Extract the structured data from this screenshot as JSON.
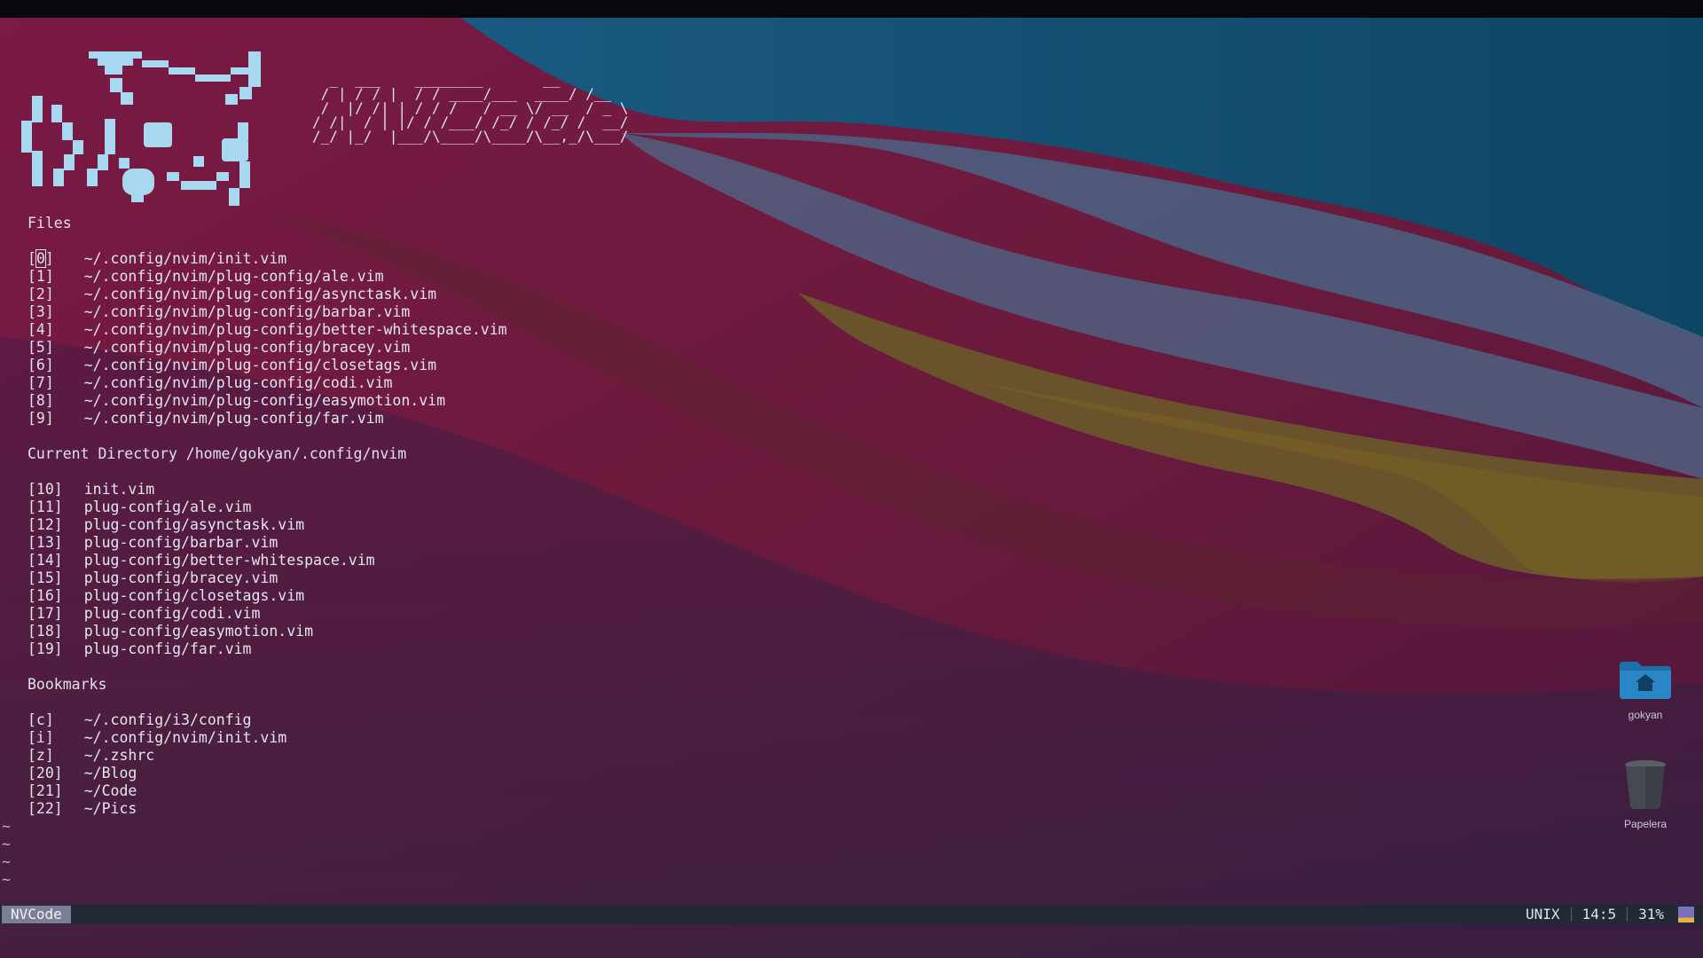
{
  "ascii_logo": "  _  ___    ________       __\n / | / / |  / / ____/___  ____/ /__\n /  |/ /| | / / /   / __ \\/ __  / _ \\\n/ /|  / | |/ / /___/ /_/ / /_/ /  __/\n/_/ |_/  |___/\\____/\\____/\\__,_/\\___/",
  "sections": {
    "files_heading": "Files",
    "current_dir_heading": "Current Directory /home/gokyan/.config/nvim",
    "bookmarks_heading": "Bookmarks"
  },
  "files": [
    {
      "index": "[0]",
      "icon": "",
      "path": "~/.config/nvim/init.vim"
    },
    {
      "index": "[1]",
      "icon": "",
      "path": "~/.config/nvim/plug-config/ale.vim"
    },
    {
      "index": "[2]",
      "icon": "",
      "path": "~/.config/nvim/plug-config/asynctask.vim"
    },
    {
      "index": "[3]",
      "icon": "",
      "path": "~/.config/nvim/plug-config/barbar.vim"
    },
    {
      "index": "[4]",
      "icon": "",
      "path": "~/.config/nvim/plug-config/better-whitespace.vim"
    },
    {
      "index": "[5]",
      "icon": "",
      "path": "~/.config/nvim/plug-config/bracey.vim"
    },
    {
      "index": "[6]",
      "icon": "",
      "path": "~/.config/nvim/plug-config/closetags.vim"
    },
    {
      "index": "[7]",
      "icon": "",
      "path": "~/.config/nvim/plug-config/codi.vim"
    },
    {
      "index": "[8]",
      "icon": "",
      "path": "~/.config/nvim/plug-config/easymotion.vim"
    },
    {
      "index": "[9]",
      "icon": "",
      "path": "~/.config/nvim/plug-config/far.vim"
    }
  ],
  "current_dir_files": [
    {
      "index": "[10]",
      "icon": "",
      "path": "init.vim"
    },
    {
      "index": "[11]",
      "icon": "",
      "path": "plug-config/ale.vim"
    },
    {
      "index": "[12]",
      "icon": "",
      "path": "plug-config/asynctask.vim"
    },
    {
      "index": "[13]",
      "icon": "",
      "path": "plug-config/barbar.vim"
    },
    {
      "index": "[14]",
      "icon": "",
      "path": "plug-config/better-whitespace.vim"
    },
    {
      "index": "[15]",
      "icon": "",
      "path": "plug-config/bracey.vim"
    },
    {
      "index": "[16]",
      "icon": "",
      "path": "plug-config/closetags.vim"
    },
    {
      "index": "[17]",
      "icon": "",
      "path": "plug-config/codi.vim"
    },
    {
      "index": "[18]",
      "icon": "",
      "path": "plug-config/easymotion.vim"
    },
    {
      "index": "[19]",
      "icon": "",
      "path": "plug-config/far.vim"
    }
  ],
  "bookmarks": [
    {
      "index": "[c]",
      "icon": "",
      "icon_name": "text-file-icon",
      "path": "~/.config/i3/config"
    },
    {
      "index": "[i]",
      "icon": "",
      "icon_name": "vim-icon",
      "path": "~/.config/nvim/init.vim"
    },
    {
      "index": "[z]",
      "icon": "",
      "icon_name": "gear-icon",
      "path": "~/.zshrc"
    },
    {
      "index": "[20]",
      "icon": "",
      "icon_name": "text-file-icon",
      "path": "~/Blog"
    },
    {
      "index": "[21]",
      "icon": "",
      "icon_name": "text-file-icon",
      "path": "~/Code"
    },
    {
      "index": "[22]",
      "icon": "",
      "icon_name": "text-file-icon",
      "path": "~/Pics"
    }
  ],
  "empty_line_markers": [
    "~",
    "~",
    "~",
    "~"
  ],
  "statusline": {
    "mode": "NVCode",
    "fileformat": "UNIX",
    "position": "14:5",
    "percent": "31%"
  },
  "desktop_icons": [
    {
      "label": "gokyan",
      "icon_name": "home-folder-icon"
    },
    {
      "label": "Papelera",
      "icon_name": "trash-icon"
    }
  ],
  "colors": {
    "text": "#dfe3ea",
    "logo": "#a8d8f0",
    "statusline_bg": "#232837",
    "mode_badge_bg": "#7a7f95",
    "scroll_indicator_top": "#7d6fbb",
    "scroll_indicator_bottom": "#e3b341"
  }
}
